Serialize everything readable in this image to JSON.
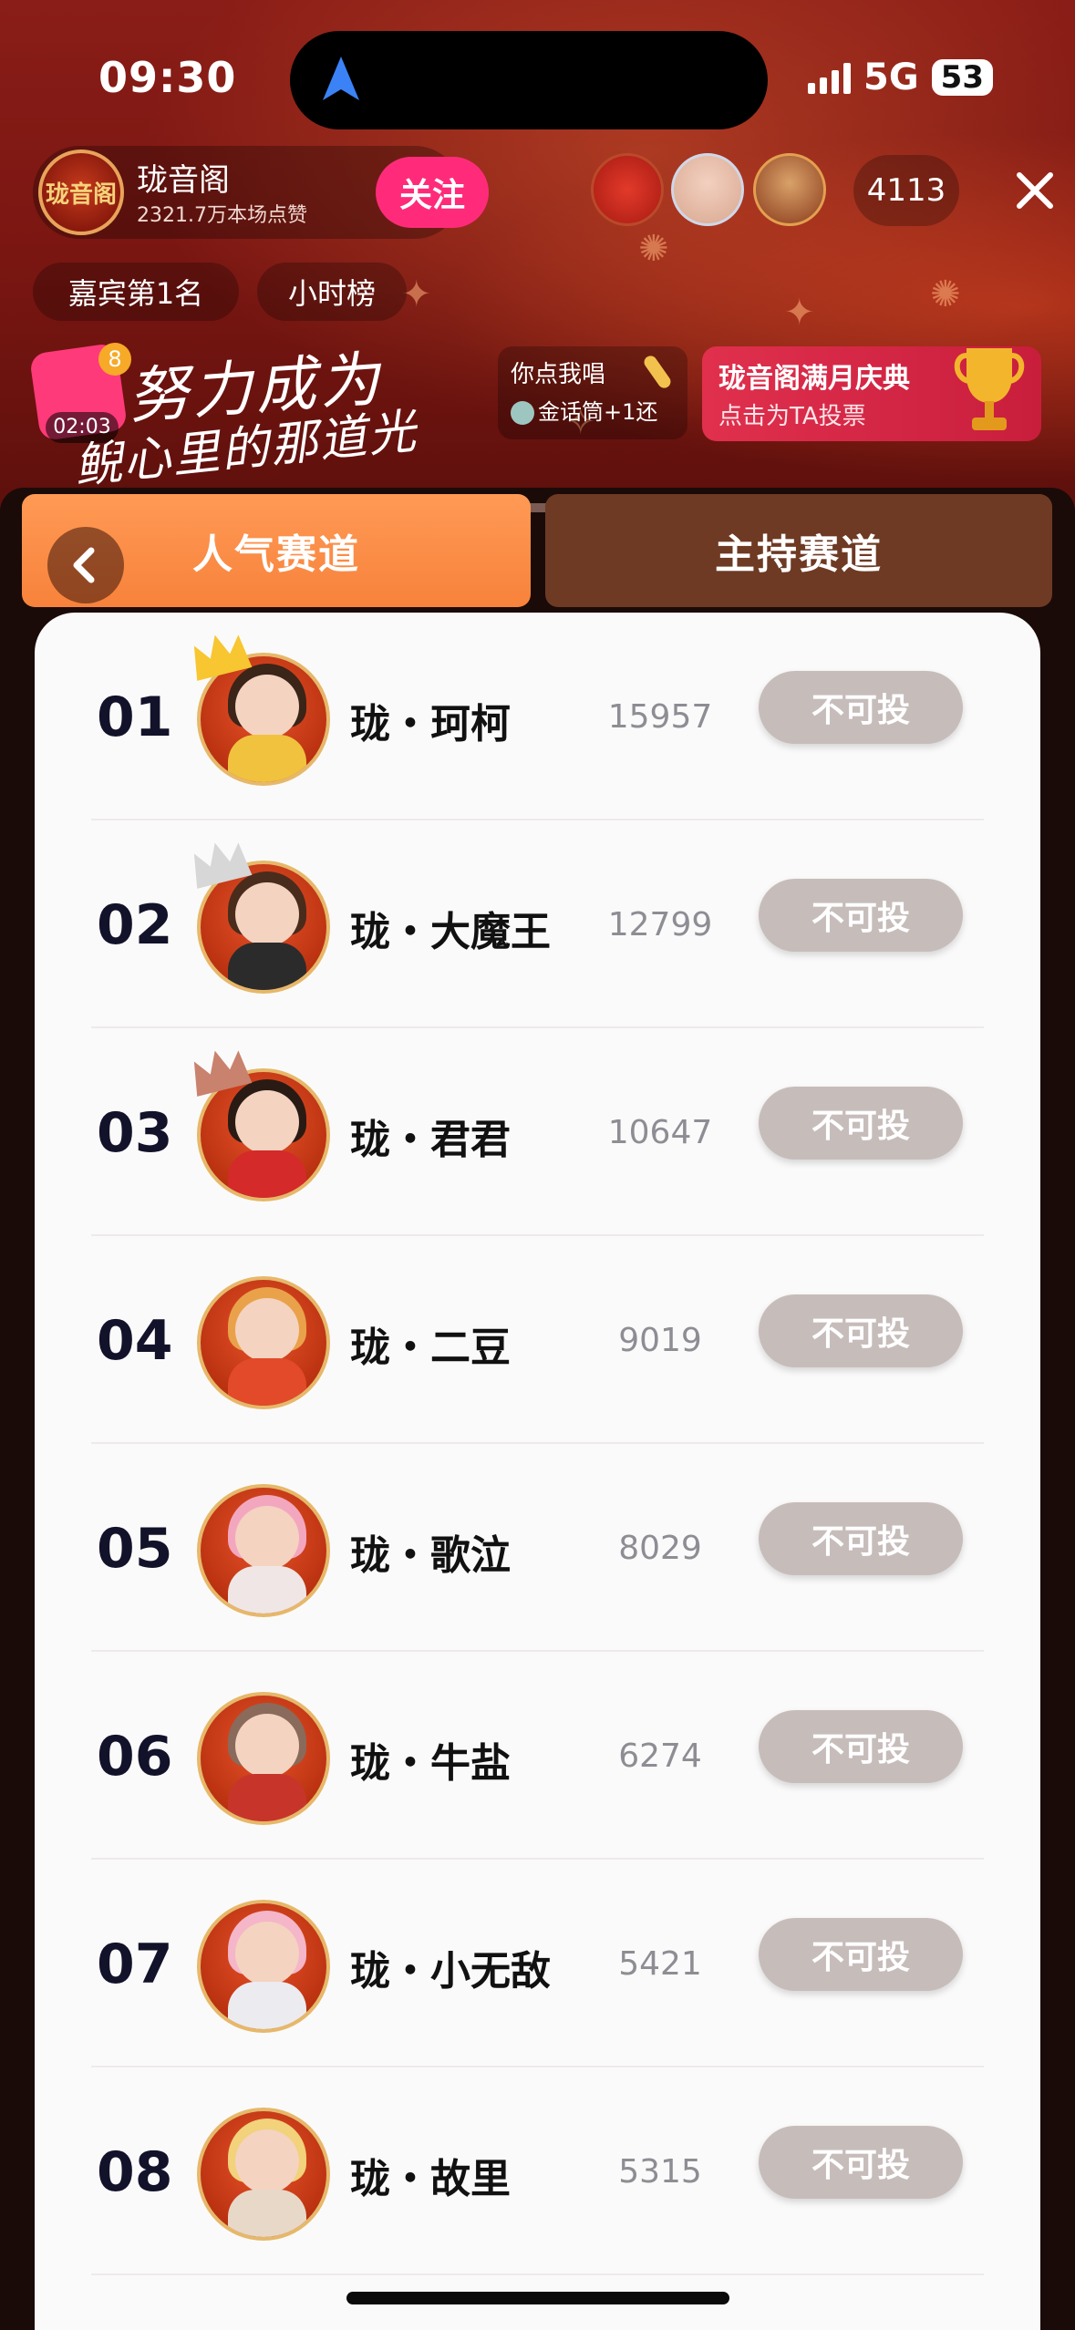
{
  "status_bar": {
    "time": "09:30",
    "network": "5G",
    "battery": "53"
  },
  "host": {
    "name": "珑音阁",
    "likes": "2321.7万本场点赞",
    "follow_label": "关注",
    "avatar_text": "珑音阁"
  },
  "viewers": {
    "count": "4113"
  },
  "chips": {
    "rank": "嘉宾第1名",
    "hourly": "小时榜"
  },
  "gift": {
    "badge": "8",
    "timer": "02:03"
  },
  "slogan": {
    "line1": "努力成为",
    "line2": "鲵心里的那道光"
  },
  "song_card": {
    "title": "你点我唱",
    "subtitle": "金话筒+1还"
  },
  "banner": {
    "title": "珑音阁满月庆典",
    "subtitle": "点击为TA投票"
  },
  "tabs": {
    "popular": "人气赛道",
    "host": "主持赛道"
  },
  "vote_label": "不可投",
  "rows": [
    {
      "rank": "01",
      "name": "珑・珂柯",
      "score": "15957",
      "crown": "gold",
      "hair": "#3b2418",
      "body": "#f1c23e"
    },
    {
      "rank": "02",
      "name": "珑・大魔王",
      "score": "12799",
      "crown": "silver",
      "hair": "#4a2c1c",
      "body": "#2b2b2b"
    },
    {
      "rank": "03",
      "name": "珑・君君",
      "score": "10647",
      "crown": "bronze",
      "hair": "#2a1a14",
      "body": "#d42a2a"
    },
    {
      "rank": "04",
      "name": "珑・二豆",
      "score": "9019",
      "crown": "",
      "hair": "#e9a24a",
      "body": "#e24a2a"
    },
    {
      "rank": "05",
      "name": "珑・歌泣",
      "score": "8029",
      "crown": "",
      "hair": "#f3a7bf",
      "body": "#f0e6e6"
    },
    {
      "rank": "06",
      "name": "珑・牛盐",
      "score": "6274",
      "crown": "",
      "hair": "#8a6a5a",
      "body": "#c7352a"
    },
    {
      "rank": "07",
      "name": "珑・小无敌",
      "score": "5421",
      "crown": "",
      "hair": "#f4b6c8",
      "body": "#ececf0"
    },
    {
      "rank": "08",
      "name": "珑・故里",
      "score": "5315",
      "crown": "",
      "hair": "#f2d27a",
      "body": "#e8d8c8"
    }
  ],
  "colors": {
    "accent_orange": "#f7823b",
    "follow_pink": "#ff2b7a",
    "inactive_tab": "#6e3a24",
    "vote_disabled": "#c6bdbb"
  }
}
